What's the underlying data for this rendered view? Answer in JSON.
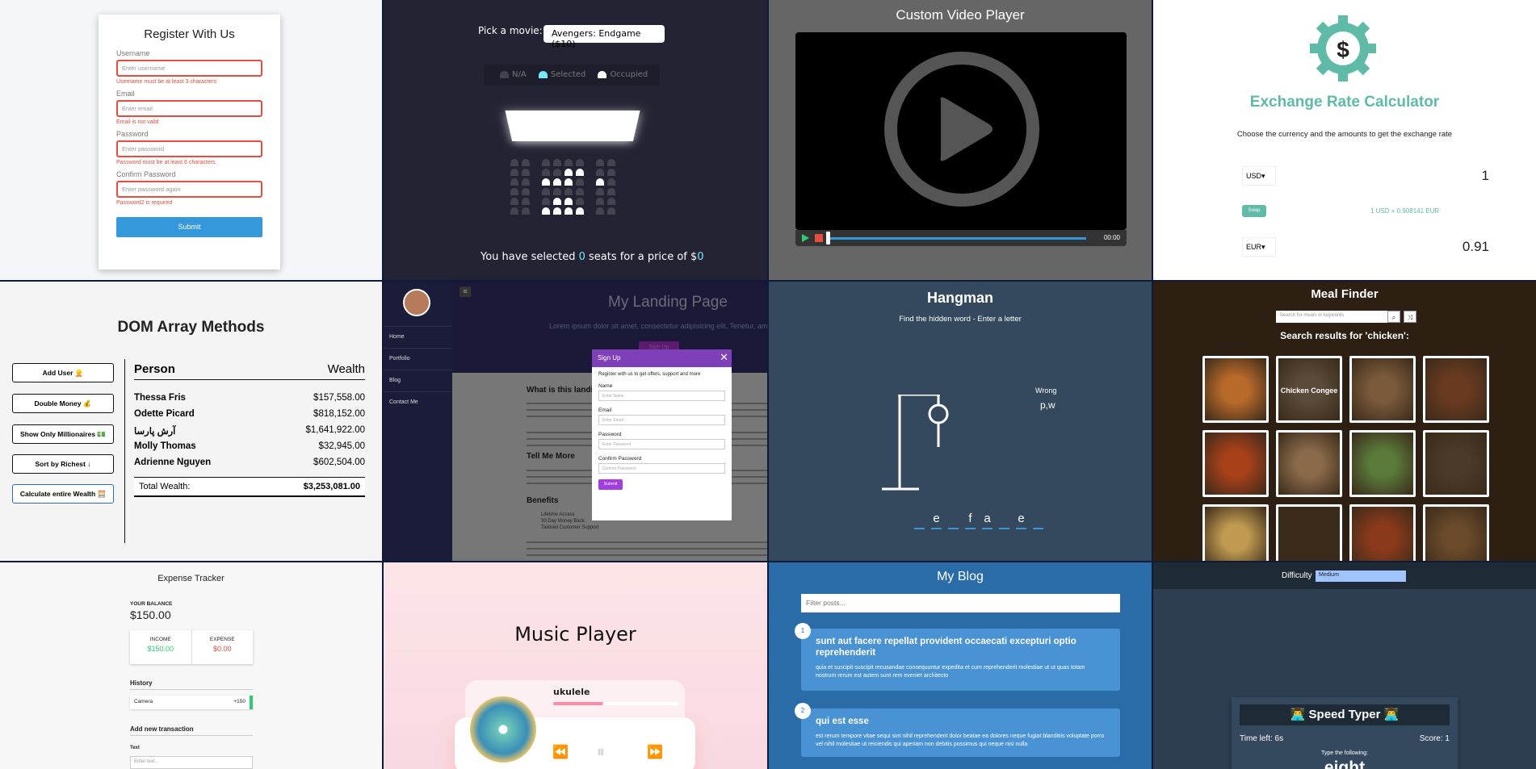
{
  "register": {
    "title": "Register With Us",
    "fields": [
      {
        "label": "Username",
        "placeholder": "Enter username",
        "error": "Username must be at least 3 characters"
      },
      {
        "label": "Email",
        "placeholder": "Enter email",
        "error": "Email is not valid"
      },
      {
        "label": "Password",
        "placeholder": "Enter password",
        "error": "Password must be at least 6 characters"
      },
      {
        "label": "Confirm Password",
        "placeholder": "Enter password again",
        "error": "Password2 is required"
      }
    ],
    "submit": "Submit",
    "error_color": "#e74c3c",
    "button_color": "#3498db"
  },
  "movie": {
    "pick_label": "Pick a movie:",
    "selected_movie": "Avengers: Endgame ($10)",
    "legend": [
      "N/A",
      "Selected",
      "Occupied"
    ],
    "total_prefix": "You have selected ",
    "count": "0",
    "total_mid": " seats for a price of $",
    "price": "0",
    "accent": "#6feaf6"
  },
  "video": {
    "title": "Custom Video Player",
    "timestamp": "00:00",
    "icons": [
      "play-icon",
      "stop-icon"
    ]
  },
  "exchange": {
    "title": "Exchange Rate Calculator",
    "description": "Choose the currency and the amounts to get the exchange rate",
    "currency_one": "USD",
    "amount_one": "1",
    "swap": "Swap",
    "rate": "1 USD = 0.908141 EUR",
    "currency_two": "EUR",
    "amount_two": "0.91",
    "accent": "#5fbaa7"
  },
  "dom": {
    "title": "DOM Array Methods",
    "buttons": [
      "Add User 👱",
      "Double Money 💰",
      "Show Only Millionaires 💵",
      "Sort by Richest ↓",
      "Calculate entire Wealth 🧮"
    ],
    "col_person": "Person",
    "col_wealth": "Wealth",
    "rows": [
      {
        "name": "Thessa Fris",
        "wealth": "$157,558.00"
      },
      {
        "name": "Odette Picard",
        "wealth": "$818,152.00"
      },
      {
        "name": "آرش پارسا",
        "wealth": "$1,641,922.00"
      },
      {
        "name": "Molly Thomas",
        "wealth": "$32,945.00"
      },
      {
        "name": "Adrienne Nguyen",
        "wealth": "$602,504.00"
      }
    ],
    "total_label": "Total Wealth:",
    "total_value": "$3,253,081.00"
  },
  "landing": {
    "nav": [
      "Home",
      "Portfolio",
      "Blog",
      "Contact Me"
    ],
    "title": "My Landing Page",
    "lorem": "Lorem ipsum dolor sit amet, consectetur adipisicing elit. Tenetur, am",
    "signup_btn": "Sign Up",
    "section1": "What is this landi",
    "section2": "Tell Me More",
    "section3": "Benefits",
    "benefits": [
      "Lifetime Access",
      "30 Day Money Back",
      "Tailored Customer Support"
    ],
    "modal": {
      "title": "Sign Up",
      "intro": "Register with us to get offers, support and more",
      "fields": [
        {
          "label": "Name",
          "placeholder": "Enter Name"
        },
        {
          "label": "Email",
          "placeholder": "Enter Email"
        },
        {
          "label": "Password",
          "placeholder": "Enter Password"
        },
        {
          "label": "Confirm Password",
          "placeholder": "Confirm Password"
        }
      ],
      "submit": "Submit"
    }
  },
  "hangman": {
    "title": "Hangman",
    "subtitle": "Find the hidden word - Enter a letter",
    "wrong_label": "Wrong",
    "wrong_letters": "p,w",
    "letters": [
      "",
      "e",
      "",
      "f",
      "a",
      "",
      "e",
      ""
    ]
  },
  "meal": {
    "title": "Meal Finder",
    "search_placeholder": "Search for meals or keywords",
    "results": "Search results for 'chicken':",
    "featured_caption": "Chicken Congee"
  },
  "expense": {
    "title": "Expense Tracker",
    "balance_label": "YOUR BALANCE",
    "balance": "$150.00",
    "income_label": "INCOME",
    "income": "$150.00",
    "expense_label": "EXPENSE",
    "expense": "$0.00",
    "history": "History",
    "item_name": "Camera",
    "item_amount": "+150",
    "add_title": "Add new transaction",
    "text_label": "Text",
    "text_placeholder": "Enter text..."
  },
  "music": {
    "title": "Music Player",
    "track": "ukulele",
    "progress": 0.4
  },
  "blog": {
    "title": "My Blog",
    "filter_placeholder": "Filter posts...",
    "posts": [
      {
        "num": "1",
        "title": "sunt aut facere repellat provident occaecati excepturi optio reprehenderit",
        "body": "quia et suscipit suscipit recusandae consequuntur expedita et cum reprehenderit molestiae ut ut quas totam nostrum rerum est autem sunt rem eveniet architecto"
      },
      {
        "num": "2",
        "title": "qui est esse",
        "body": "est rerum tempore vitae sequi sint nihil reprehenderit dolor beatae ea dolores neque fugiat blanditiis voluptate porro vel nihil molestiae ut reiciendis qui aperiam non debitis possimus qui neque nisi nulla"
      }
    ]
  },
  "typer": {
    "difficulty_label": "Difficulty",
    "difficulty": "Medium",
    "title": "👨‍💻 Speed Typer 👨‍💻",
    "time_left": "Time left: 6s",
    "score": "Score: 1",
    "instruction": "Type the following:",
    "word": "eight"
  }
}
